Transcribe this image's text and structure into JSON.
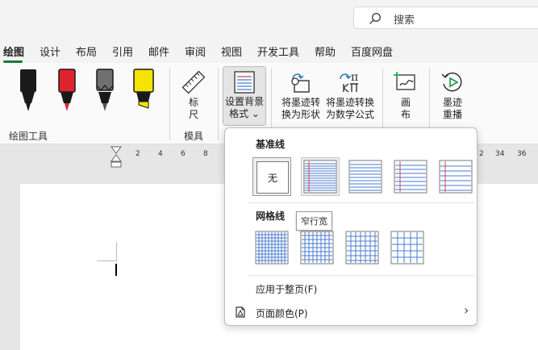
{
  "search": {
    "placeholder": "搜索"
  },
  "tabs": [
    "绘图",
    "设计",
    "布局",
    "引用",
    "邮件",
    "审阅",
    "视图",
    "开发工具",
    "帮助",
    "百度网盘"
  ],
  "ribbon": {
    "draw_tools_label": "绘图工具",
    "pens": [
      {
        "name": "black-pen",
        "color": "#1a1a1a"
      },
      {
        "name": "red-pen",
        "color": "#e0242f"
      },
      {
        "name": "gray-pen",
        "color": "#707070"
      },
      {
        "name": "yellow-highlighter",
        "color": "#f4e400"
      }
    ],
    "ruler_line1": "标",
    "ruler_line2": "尺",
    "stencil_label": "模具",
    "bg_format_line1": "设置背景",
    "bg_format_line2": "格式 ⌄",
    "ink_to_shape_line1": "将墨迹转",
    "ink_to_shape_line2": "换为形状",
    "ink_to_math_line1": "将墨迹转换",
    "ink_to_math_line2": "为数学公式",
    "canvas_line1": "画",
    "canvas_line2": "布",
    "replay_line1": "墨迹",
    "replay_line2": "重播"
  },
  "ruler": {
    "numbers": [
      "2",
      "4",
      "6",
      "8",
      "2",
      "34",
      "36"
    ]
  },
  "dropdown": {
    "rule_lines_title": "基准线",
    "none_label": "无",
    "grid_title": "网格线",
    "tooltip": "窄行宽",
    "apply_to_all": "应用于整页(F)",
    "page_color": "页面颜色(P)",
    "page_color_arrow": "›"
  },
  "colors": {
    "accent": "#1a7a3a",
    "line_blue": "#4a7bd1",
    "margin_red": "#d04050"
  }
}
